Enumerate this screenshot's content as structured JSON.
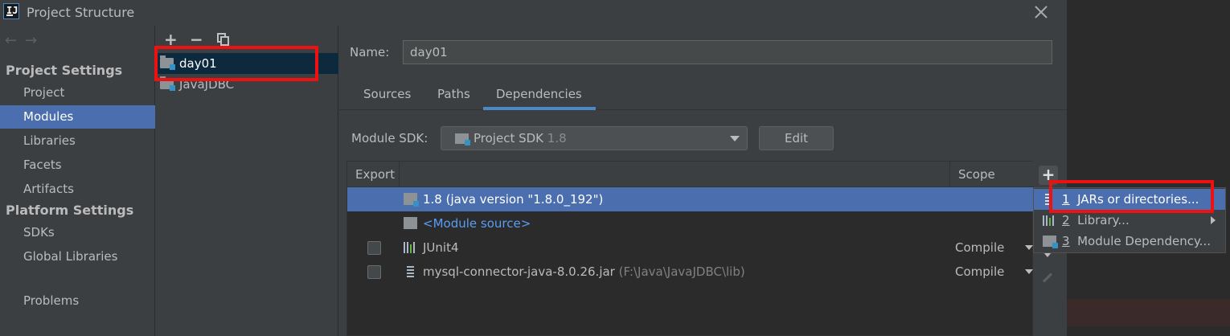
{
  "window": {
    "title": "Project Structure",
    "app_icon_label": "IJ"
  },
  "nav": {
    "back_arrow": "←",
    "forward_arrow": "→",
    "project_settings_heading": "Project Settings",
    "platform_settings_heading": "Platform Settings",
    "items": [
      {
        "label": "Project"
      },
      {
        "label": "Modules",
        "selected": true
      },
      {
        "label": "Libraries"
      },
      {
        "label": "Facets"
      },
      {
        "label": "Artifacts"
      }
    ],
    "platform_items": [
      {
        "label": "SDKs"
      },
      {
        "label": "Global Libraries"
      }
    ],
    "problems": "Problems"
  },
  "modules": {
    "toolbar": {
      "add": "+",
      "remove": "−"
    },
    "items": [
      {
        "name": "day01",
        "selected": true
      },
      {
        "name": "JavaJDBC"
      }
    ]
  },
  "detail": {
    "name_label": "Name:",
    "name_value": "day01",
    "tabs": [
      "Sources",
      "Paths",
      "Dependencies"
    ],
    "active_tab": "Dependencies",
    "module_sdk_label": "Module SDK:",
    "module_sdk_value": "Project SDK",
    "module_sdk_version": "1.8",
    "edit_button": "Edit",
    "table": {
      "headers": {
        "export": "Export",
        "scope": "Scope"
      },
      "rows": [
        {
          "name": "1.8 (java version \"1.8.0_192\")",
          "selected": true
        },
        {
          "name": "<Module source>"
        },
        {
          "name": "JUnit4",
          "scope": "Compile",
          "checked": false
        },
        {
          "name": "mysql-connector-java-8.0.26.jar",
          "path": "(F:\\Java\\JavaJDBC\\lib)",
          "scope": "Compile",
          "checked": false
        }
      ]
    },
    "side_add": "+"
  },
  "popup_menu": {
    "items": [
      {
        "num": "1",
        "label": "JARs or directories...",
        "selected": true
      },
      {
        "num": "2",
        "label": "Library...",
        "submenu": true
      },
      {
        "num": "3",
        "label": "Module Dependency..."
      }
    ]
  },
  "colors": {
    "selection": "#4b6eaf",
    "annotation": "#ee1111",
    "link": "#589df6"
  }
}
